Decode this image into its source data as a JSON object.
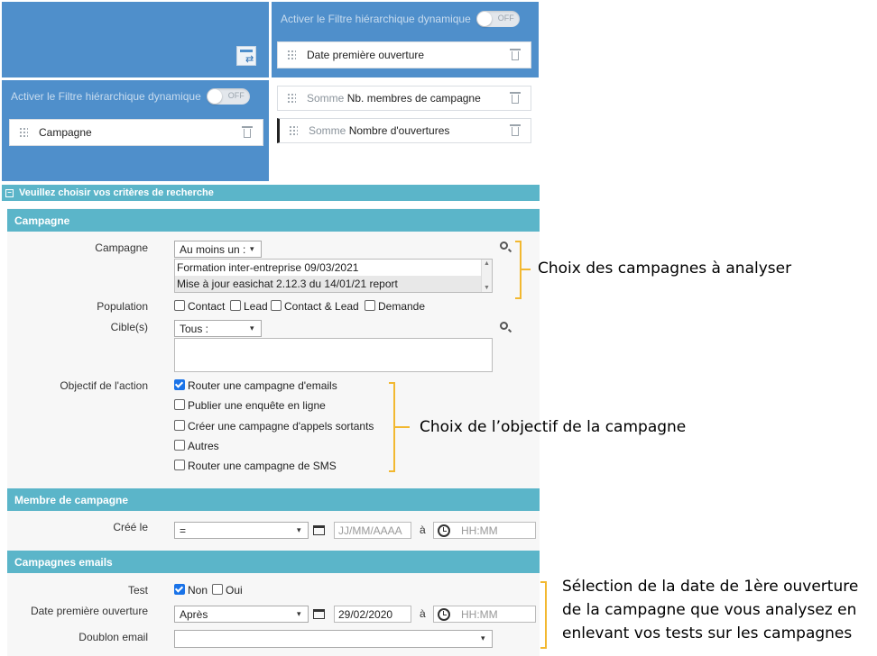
{
  "top_right_panel": {
    "toggle_label": "Activer le Filtre hiérarchique dynamique",
    "toggle_state": "OFF",
    "chip_label": "Date première ouverture"
  },
  "left_panel": {
    "toggle_label": "Activer le Filtre hiérarchique dynamique",
    "toggle_state": "OFF",
    "chip_label": "Campagne"
  },
  "measures": [
    {
      "prefix": "Somme",
      "label": "Nb. membres de campagne"
    },
    {
      "prefix": "Somme",
      "label": "Nombre d'ouvertures"
    }
  ],
  "criteria_header": "Veuillez choisir vos critères de recherche",
  "sections": {
    "campagne": "Campagne",
    "membre": "Membre de campagne",
    "emails": "Campagnes emails"
  },
  "form": {
    "campagne_label": "Campagne",
    "campagne_select": "Au moins un :",
    "campagne_options": [
      "Formation inter-entreprise 09/03/2021",
      "Mise à jour easichat 2.12.3 du 14/01/21 report"
    ],
    "population_label": "Population",
    "population_options": [
      {
        "label": "Contact",
        "checked": false
      },
      {
        "label": "Lead",
        "checked": false
      },
      {
        "label": "Contact & Lead",
        "checked": false
      },
      {
        "label": "Demande",
        "checked": false
      }
    ],
    "cibles_label": "Cible(s)",
    "cibles_select": "Tous :",
    "objectif_label": "Objectif de l'action",
    "objectif_options": [
      {
        "label": "Router une campagne d'emails",
        "checked": true
      },
      {
        "label": "Publier une enquête en ligne",
        "checked": false
      },
      {
        "label": "Créer une campagne d'appels sortants",
        "checked": false
      },
      {
        "label": "Autres",
        "checked": false
      },
      {
        "label": "Router une campagne de SMS",
        "checked": false
      }
    ],
    "cree_le_label": "Créé le",
    "cree_le_op": "=",
    "date_placeholder": "JJ/MM/AAAA",
    "a_label": "à",
    "time_placeholder": "HH:MM",
    "test_label": "Test",
    "test_options": [
      {
        "label": "Non",
        "checked": true
      },
      {
        "label": "Oui",
        "checked": false
      }
    ],
    "date_ouverture_label": "Date première ouverture",
    "date_ouverture_op": "Après",
    "date_ouverture_value": "29/02/2020",
    "doublon_label": "Doublon email",
    "doublon_value": ""
  },
  "annotations": {
    "campagnes": "Choix des campagnes à analyser",
    "objectif": "Choix de l’objectif  de la campagne",
    "date_line1": "Sélection de la date de 1ère ouverture",
    "date_line2": "de la campagne que vous analysez en",
    "date_line3": "enlevant vos tests sur les campagnes"
  },
  "colors": {
    "panel_blue": "#4f8fcb",
    "section_teal": "#5bb5c9",
    "annotation_brace": "#f2b830"
  }
}
